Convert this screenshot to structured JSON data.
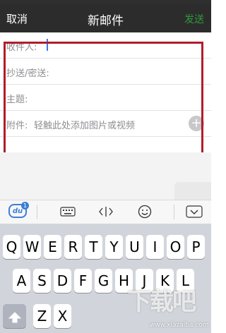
{
  "navbar": {
    "cancel_label": "取消",
    "title": "新邮件",
    "send_label": "发送",
    "send_color": "#2e9a3c"
  },
  "form": {
    "to_label": "收件人:",
    "cc_label": "抄送/密送:",
    "subject_label": "主题:",
    "attach_label": "附件:",
    "attach_hint": "轻触此处添加图片或视频",
    "add_icon": "+"
  },
  "toolbar": {
    "du_logo": "du",
    "du_badge": "1",
    "items": [
      {
        "name": "du-keyboard-logo-icon"
      },
      {
        "name": "keyboard-icon"
      },
      {
        "name": "cursor-move-icon"
      },
      {
        "name": "emoji-icon"
      },
      {
        "name": "hide-keyboard-icon"
      }
    ]
  },
  "keyboard": {
    "row1": [
      "Q",
      "W",
      "E",
      "R",
      "T",
      "Y",
      "U",
      "I",
      "O",
      "P"
    ],
    "row2": [
      "A",
      "S",
      "D",
      "F",
      "G",
      "H",
      "J",
      "K",
      "L"
    ],
    "row3": [
      "Z",
      "X"
    ]
  },
  "watermark": {
    "text": "下载吧",
    "url": "www.xiazaiba.com"
  },
  "colors": {
    "navbar_bg": "#2c2c2c",
    "highlight_frame": "#b01d2b",
    "cursor": "#3478f6"
  }
}
